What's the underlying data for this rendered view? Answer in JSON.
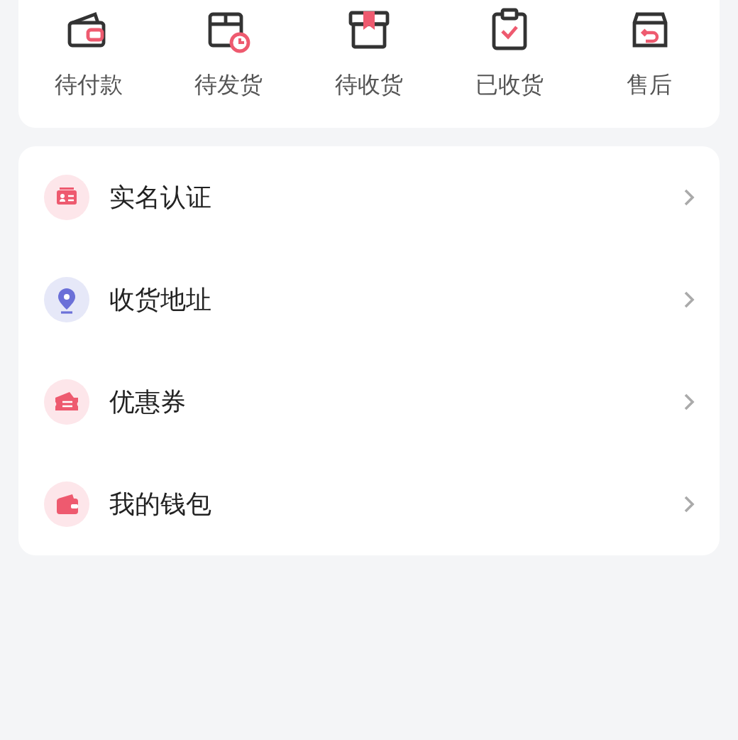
{
  "order_status": [
    {
      "label": "待付款"
    },
    {
      "label": "待发货"
    },
    {
      "label": "待收货"
    },
    {
      "label": "已收货"
    },
    {
      "label": "售后"
    }
  ],
  "menu": [
    {
      "label": "实名认证"
    },
    {
      "label": "收货地址"
    },
    {
      "label": "优惠券"
    },
    {
      "label": "我的钱包"
    }
  ]
}
